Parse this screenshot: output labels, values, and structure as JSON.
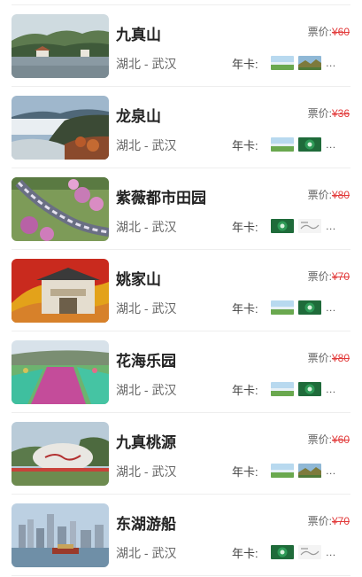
{
  "list": {
    "price_label": "票价:",
    "card_label": "年卡:",
    "more": "…",
    "items": [
      {
        "name": "九真山",
        "location": "湖北 - 武汉",
        "price": "¥60",
        "thumb": "lake-pavilion",
        "cards": [
          "landscape-card",
          "landscape-card-2"
        ]
      },
      {
        "name": "龙泉山",
        "location": "湖北 - 武汉",
        "price": "¥36",
        "thumb": "sea-of-clouds",
        "cards": [
          "landscape-card",
          "green-card"
        ]
      },
      {
        "name": "紫薇都市田园",
        "location": "湖北 - 武汉",
        "price": "¥80",
        "thumb": "flower-train",
        "cards": [
          "green-card",
          "white-card"
        ]
      },
      {
        "name": "姚家山",
        "location": "湖北 - 武汉",
        "price": "¥70",
        "thumb": "memorial-gate",
        "cards": [
          "landscape-card",
          "green-card"
        ]
      },
      {
        "name": "花海乐园",
        "location": "湖北 - 武汉",
        "price": "¥80",
        "thumb": "flower-slope",
        "cards": [
          "landscape-card",
          "green-card"
        ]
      },
      {
        "name": "九真桃源",
        "location": "湖北 - 武汉",
        "price": "¥60",
        "thumb": "stone-garden",
        "cards": [
          "landscape-card",
          "landscape-card-2"
        ]
      },
      {
        "name": "东湖游船",
        "location": "湖北 - 武汉",
        "price": "¥70",
        "thumb": "city-lake-boat",
        "cards": [
          "green-card",
          "white-card"
        ]
      }
    ]
  }
}
